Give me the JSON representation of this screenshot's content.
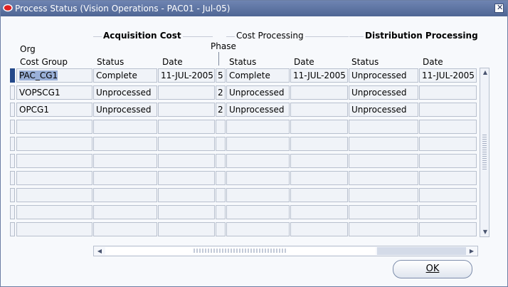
{
  "window": {
    "title": "Process Status (Vision Operations - PAC01 - Jul-05)",
    "close_symbol": "✕"
  },
  "groups": {
    "acquisition": "Acquisition Cost",
    "cost_processing": "Cost Processing",
    "distribution": "Distribution Processing"
  },
  "headers": {
    "org": "Org",
    "cost_group": "Cost Group",
    "acq_status": "Status",
    "acq_date": "Date",
    "phase": "Phase",
    "cp_status": "Status",
    "cp_date": "Date",
    "dist_status": "Status",
    "dist_date": "Date"
  },
  "rows": [
    {
      "cost_group": "PAC_CG1",
      "acq_status": "Complete",
      "acq_date": "11-JUL-2005",
      "phase": "5",
      "cp_status": "Complete",
      "cp_date": "11-JUL-2005",
      "dist_status": "Unprocessed",
      "dist_date": "11-JUL-2005"
    },
    {
      "cost_group": "VOPSCG1",
      "acq_status": "Unprocessed",
      "acq_date": "",
      "phase": "2",
      "cp_status": "Unprocessed",
      "cp_date": "",
      "dist_status": "Unprocessed",
      "dist_date": ""
    },
    {
      "cost_group": "OPCG1",
      "acq_status": "Unprocessed",
      "acq_date": "",
      "phase": "2",
      "cp_status": "Unprocessed",
      "cp_date": "",
      "dist_status": "Unprocessed",
      "dist_date": ""
    },
    {
      "cost_group": "",
      "acq_status": "",
      "acq_date": "",
      "phase": "",
      "cp_status": "",
      "cp_date": "",
      "dist_status": "",
      "dist_date": ""
    },
    {
      "cost_group": "",
      "acq_status": "",
      "acq_date": "",
      "phase": "",
      "cp_status": "",
      "cp_date": "",
      "dist_status": "",
      "dist_date": ""
    },
    {
      "cost_group": "",
      "acq_status": "",
      "acq_date": "",
      "phase": "",
      "cp_status": "",
      "cp_date": "",
      "dist_status": "",
      "dist_date": ""
    },
    {
      "cost_group": "",
      "acq_status": "",
      "acq_date": "",
      "phase": "",
      "cp_status": "",
      "cp_date": "",
      "dist_status": "",
      "dist_date": ""
    },
    {
      "cost_group": "",
      "acq_status": "",
      "acq_date": "",
      "phase": "",
      "cp_status": "",
      "cp_date": "",
      "dist_status": "",
      "dist_date": ""
    },
    {
      "cost_group": "",
      "acq_status": "",
      "acq_date": "",
      "phase": "",
      "cp_status": "",
      "cp_date": "",
      "dist_status": "",
      "dist_date": ""
    },
    {
      "cost_group": "",
      "acq_status": "",
      "acq_date": "",
      "phase": "",
      "cp_status": "",
      "cp_date": "",
      "dist_status": "",
      "dist_date": ""
    }
  ],
  "buttons": {
    "ok": "OK"
  },
  "scroll": {
    "up": "▲",
    "down": "▼",
    "left": "◀",
    "right": "▶"
  },
  "colors": {
    "titlebar": "#5a70a0",
    "selection": "#9ab0d8",
    "active_row": "#24498a"
  }
}
